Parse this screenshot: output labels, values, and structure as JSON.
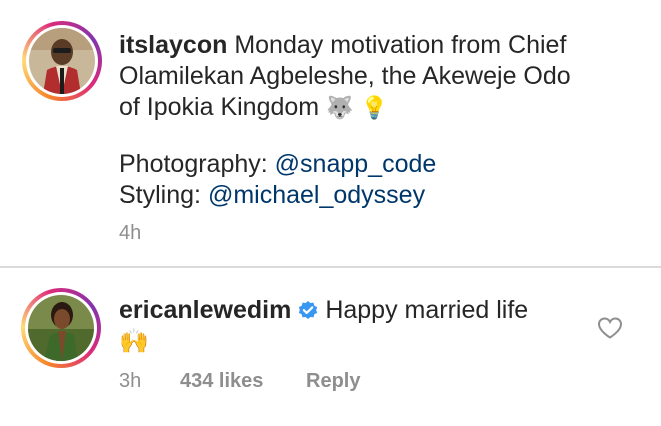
{
  "post": {
    "username": "itslaycon",
    "caption_line1": "Monday motivation from Chief",
    "caption_line2": "Olamilekan Agbeleshe, the Akeweje Odo",
    "caption_line3": "of Ipokia Kingdom",
    "emoji_1": "🐺",
    "emoji_2": "💡",
    "photography_label": "Photography:",
    "photography_handle": "@snapp_code",
    "styling_label": "Styling:",
    "styling_handle": "@michael_odyssey",
    "time": "4h"
  },
  "comment": {
    "username": "ericanlewedim",
    "text": "Happy married life",
    "emoji": "🙌",
    "time": "3h",
    "likes": "434 likes",
    "reply": "Reply"
  },
  "colors": {
    "text": "#262626",
    "link": "#00376b",
    "meta": "#8e8e8e",
    "verified": "#3897f0"
  },
  "icons": [
    "verified-badge-icon",
    "heart-outline-icon"
  ]
}
